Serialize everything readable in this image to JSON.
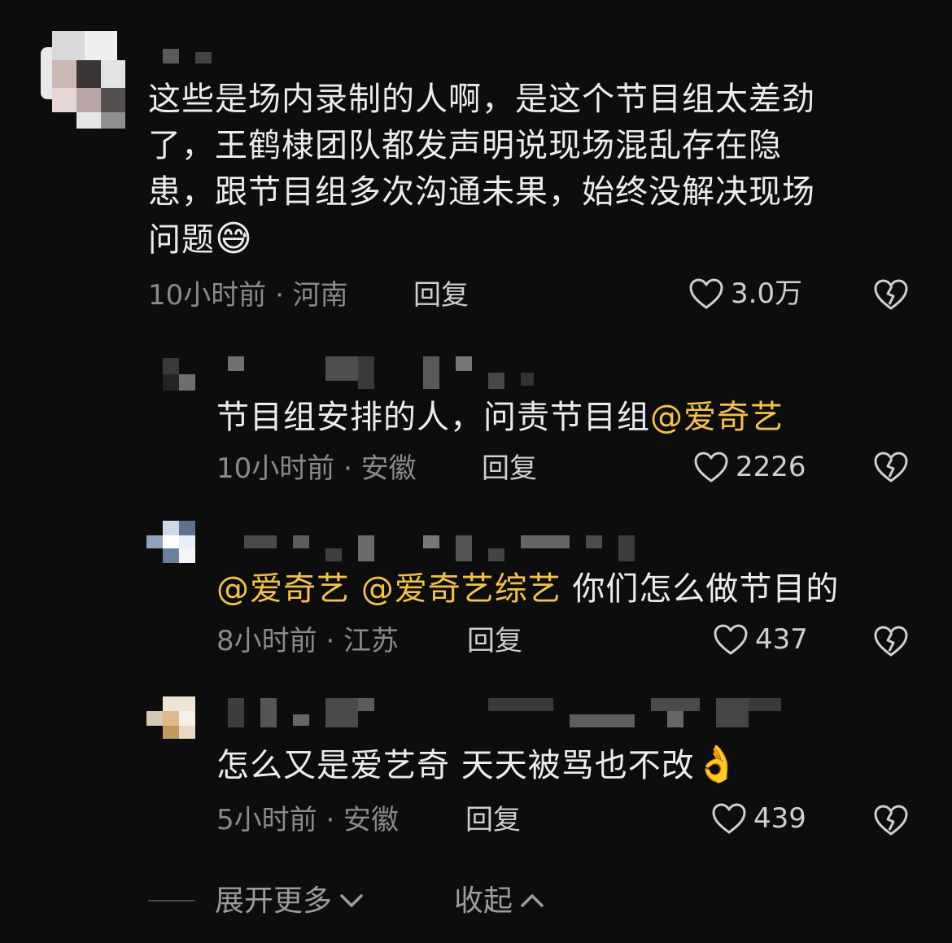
{
  "comments": [
    {
      "text_lines": [
        "这些是场内录制的人啊，是这个节目组太差劲",
        "了，王鹤棣团队都发声明说现场混乱存在隐",
        "患，跟节目组多次沟通未果，始终没解决现场",
        "问题"
      ],
      "emoji": "😅",
      "meta": "10小时前 · 河南",
      "reply_label": "回复",
      "likes": "3.0万"
    }
  ],
  "replies": [
    {
      "text": "节目组安排的人，问责节目组",
      "mentions": [
        "@爱奇艺"
      ],
      "meta": "10小时前 · 安徽",
      "reply_label": "回复",
      "likes": "2226"
    },
    {
      "mentions": [
        "@爱奇艺",
        "@爱奇艺综艺"
      ],
      "text": "你们怎么做节目的",
      "meta": "8小时前 · 江苏",
      "reply_label": "回复",
      "likes": "437"
    },
    {
      "text": "怎么又是爱艺奇 天天被骂也不改",
      "emoji": "👌",
      "meta": "5小时前 · 安徽",
      "reply_label": "回复",
      "likes": "439"
    }
  ],
  "footer": {
    "expand_label": "展开更多",
    "collapse_label": "收起"
  },
  "icons": {
    "like": "heart-outline-icon",
    "dislike": "broken-heart-icon",
    "expand": "chevron-down-icon",
    "collapse": "chevron-up-icon"
  },
  "colors": {
    "background": "#0d0d0d",
    "mention": "#f2c14e",
    "text": "#ececec",
    "meta": "#8a8a8a"
  }
}
